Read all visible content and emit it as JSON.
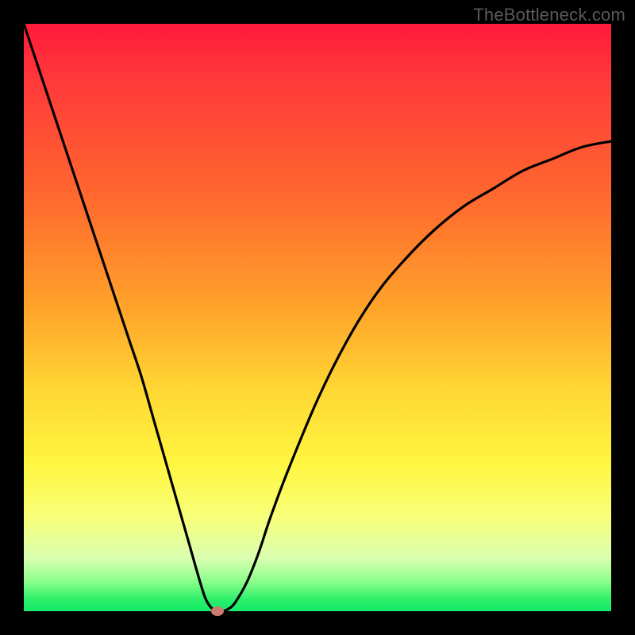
{
  "watermark": "TheBottleneck.com",
  "chart_data": {
    "type": "line",
    "title": "",
    "xlabel": "",
    "ylabel": "",
    "xlim": [
      0,
      100
    ],
    "ylim": [
      0,
      100
    ],
    "grid": false,
    "legend": false,
    "background_gradient": {
      "top": "#ff1a3a",
      "mid_upper": "#ff6a2e",
      "mid": "#ffd633",
      "mid_lower": "#f8ff7a",
      "bottom": "#15e969"
    },
    "series": [
      {
        "name": "bottleneck-curve",
        "color": "#000000",
        "x": [
          0,
          2,
          4,
          6,
          8,
          10,
          12,
          14,
          16,
          18,
          20,
          22,
          24,
          26,
          28,
          30,
          31,
          32,
          33,
          34,
          35,
          36,
          38,
          40,
          42,
          45,
          50,
          55,
          60,
          65,
          70,
          75,
          80,
          85,
          90,
          95,
          100
        ],
        "y": [
          100,
          94,
          88,
          82,
          76,
          70,
          64,
          58,
          52,
          46,
          40,
          33,
          26,
          19,
          12,
          5,
          2,
          0.5,
          0,
          0,
          0.5,
          1.5,
          5,
          10,
          16,
          24,
          36,
          46,
          54,
          60,
          65,
          69,
          72,
          75,
          77,
          79,
          80
        ]
      }
    ],
    "marker": {
      "name": "optimal-point",
      "x": 33,
      "y": 0,
      "color": "#cd7a70"
    }
  }
}
